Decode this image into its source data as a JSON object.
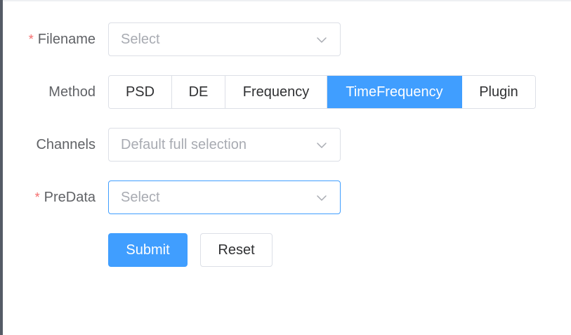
{
  "form": {
    "filename": {
      "label": "Filename",
      "required_mark": "*",
      "placeholder": "Select",
      "icon": "chevron-down-icon"
    },
    "method": {
      "label": "Method",
      "options": [
        "PSD",
        "DE",
        "Frequency",
        "TimeFrequency",
        "Plugin"
      ],
      "selected": "TimeFrequency"
    },
    "channels": {
      "label": "Channels",
      "placeholder": "Default full selection",
      "icon": "chevron-down-icon"
    },
    "predata": {
      "label": "PreData",
      "required_mark": "*",
      "placeholder": "Select",
      "icon": "chevron-down-icon"
    },
    "actions": {
      "submit_label": "Submit",
      "reset_label": "Reset"
    }
  },
  "colors": {
    "primary": "#409eff",
    "required": "#f56c6c",
    "border": "#dcdfe6",
    "placeholder": "#a8abb2",
    "label": "#606266"
  }
}
